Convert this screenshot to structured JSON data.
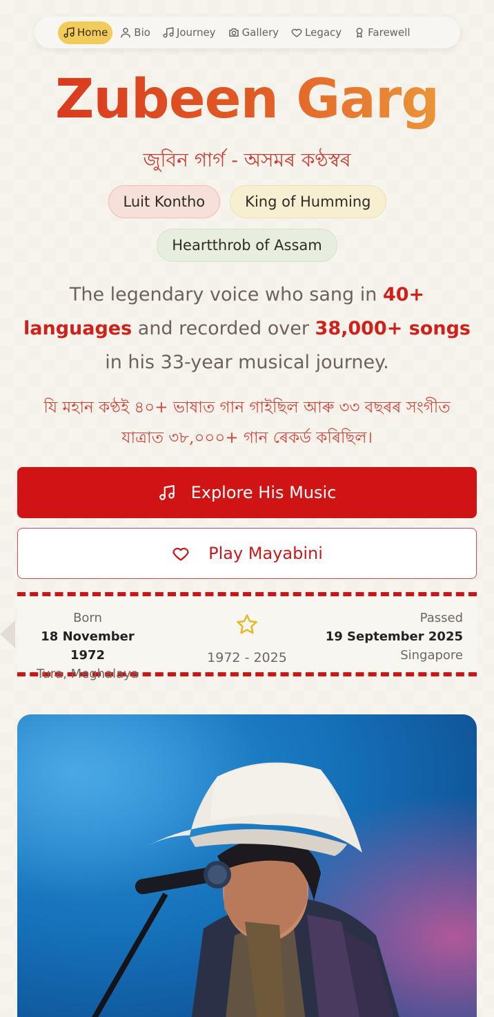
{
  "nav": {
    "items": [
      {
        "label": "Home",
        "icon": "music-note-icon",
        "active": true
      },
      {
        "label": "Bio",
        "icon": "user-icon",
        "active": false
      },
      {
        "label": "Journey",
        "icon": "music-note-icon",
        "active": false
      },
      {
        "label": "Gallery",
        "icon": "camera-icon",
        "active": false
      },
      {
        "label": "Legacy",
        "icon": "heart-icon",
        "active": false
      },
      {
        "label": "Farewell",
        "icon": "award-icon",
        "active": false
      }
    ],
    "active_color": "#f2cc5a"
  },
  "hero": {
    "title": "Zubeen Garg",
    "subtitle": "জুবিন গাৰ্গ - অসমৰ কণ্ঠস্বৰ",
    "chips": [
      "Luit Kontho",
      "King of Humming",
      "Heartthrob of Assam"
    ],
    "lead_part1": "The legendary voice who sang in ",
    "lead_highlight1": "40+ languages",
    "lead_part2": " and recorded over ",
    "lead_highlight2": "38,000+ songs",
    "lead_part3": " in his 33-year musical journey.",
    "lead_assamese": "যি মহান কণ্ঠই ৪০+ ভাষাত গান গাইছিল আৰু ৩৩ বছৰৰ সংগীত যাত্ৰাত ৩৮,০০০+ গান ৰেকৰ্ড কৰিছিল।"
  },
  "buttons": {
    "primary_label": "Explore His Music",
    "primary_icon": "music-note-icon",
    "secondary_label": "Play Mayabini",
    "secondary_icon": "heart-icon"
  },
  "dates": {
    "born_label": "Born",
    "born_date": "18 November 1972",
    "born_place": "Tura, Meghalaya",
    "range": "1972 - 2025",
    "passed_label": "Passed",
    "passed_date": "19 September 2025",
    "passed_place": "Singapore"
  },
  "colors": {
    "accent_red": "#d01313",
    "title_gradient_start": "#d8301d",
    "title_gradient_end": "#eea640"
  }
}
